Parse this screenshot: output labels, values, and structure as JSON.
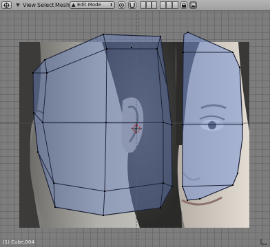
{
  "header": {
    "menus": [
      "View",
      "Select",
      "Mesh"
    ],
    "mode": {
      "label": "Edit Mode",
      "icon": "edit-mode-icon"
    }
  },
  "viewport": {
    "status_text": "(1) Cube.004",
    "colors": {
      "background": "#7d7d7d",
      "mesh_fill": "#6b85c5",
      "mesh_edge": "#1e2238",
      "vertex": "#000000",
      "cursor": "#cc2222"
    }
  }
}
